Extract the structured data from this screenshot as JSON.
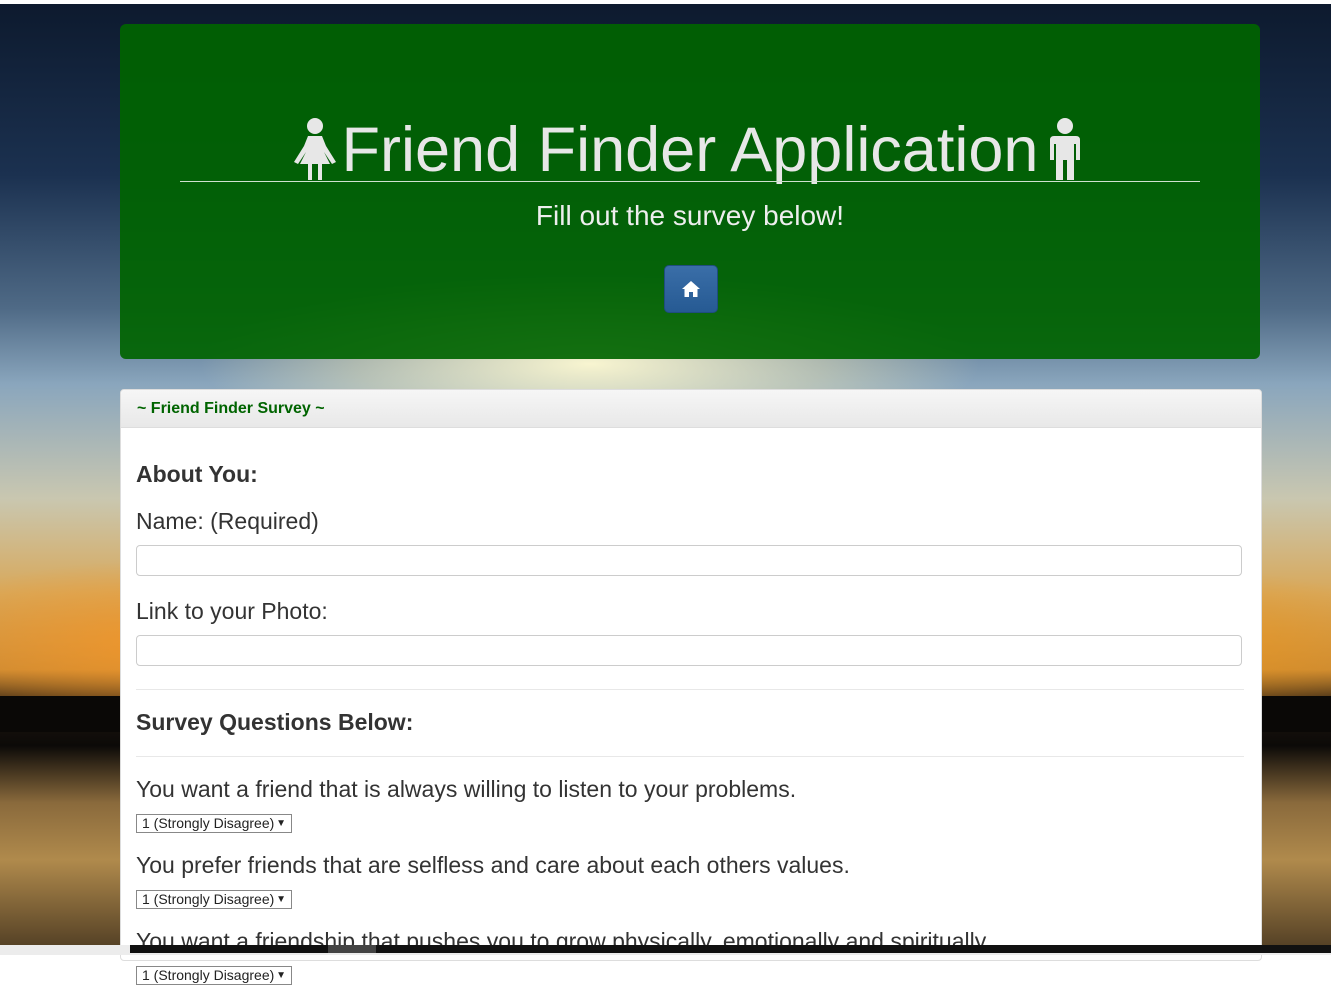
{
  "header": {
    "title": "Friend Finder Application",
    "subtitle": "Fill out the survey below!",
    "home_button_icon": "home-icon",
    "left_icon": "female-icon",
    "right_icon": "male-icon"
  },
  "panel": {
    "heading": "~ Friend Finder Survey ~",
    "about_heading": "About You:",
    "name_label": "Name: (Required)",
    "name_value": "",
    "photo_label": "Link to your Photo:",
    "photo_value": "",
    "questions_heading": "Survey Questions Below:",
    "questions": [
      {
        "text": "You want a friend that is always willing to listen to your problems.",
        "selected": "1 (Strongly Disagree)"
      },
      {
        "text": "You prefer friends that are selfless and care about each others values.",
        "selected": "1 (Strongly Disagree)"
      },
      {
        "text": "You want a friendship that pushes you to grow physically, emotionally and spiritually.",
        "selected": "1 (Strongly Disagree)"
      }
    ]
  },
  "colors": {
    "header_bg": "#006400",
    "heading_text": "#006400",
    "button": "#2e6da4"
  }
}
